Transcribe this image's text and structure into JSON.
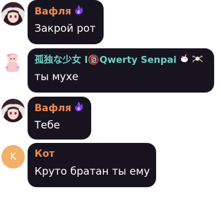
{
  "chat": {
    "messages": [
      {
        "author": "Вафля",
        "author_color": "#f08a4b",
        "text": "Закрой рот",
        "badge_icon": "purple-flame-icon"
      },
      {
        "author": "孤独な少女 I🔞Qwerty Senpai",
        "author_color": "#6fd3c4",
        "text": "ты мухе",
        "badge_icon": "unicorn-icon"
      },
      {
        "author": "Вафля",
        "author_color": "#f08a4b",
        "text": "Тебе",
        "badge_icon": "purple-flame-icon"
      },
      {
        "author": "Кот",
        "author_color": "#f08a4b",
        "text": "Круто братан ты ему",
        "avatar_letter": "K",
        "avatar_color": "#f1b169"
      }
    ]
  }
}
